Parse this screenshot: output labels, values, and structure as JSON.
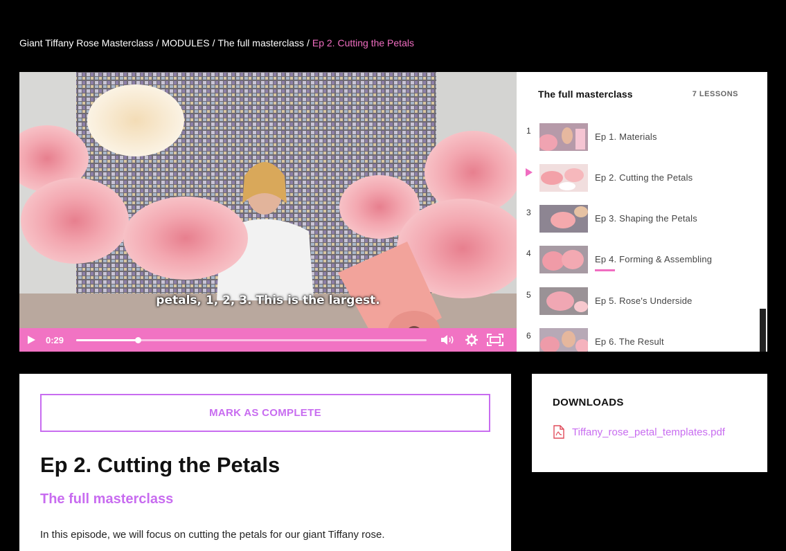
{
  "breadcrumb": {
    "course": "Giant Tiffany Rose Masterclass",
    "section": "MODULES",
    "module": "The full masterclass",
    "current": "Ep 2. Cutting the Petals",
    "separator": "/"
  },
  "video": {
    "caption": "petals, 1, 2, 3. This is the largest.",
    "time": "0:29",
    "progress": 0.175,
    "controls": [
      "play-icon",
      "volume-icon",
      "settings-icon",
      "fullscreen-icon"
    ]
  },
  "lessons": {
    "title": "The full masterclass",
    "count": "7 LESSONS",
    "items": [
      {
        "num": "1",
        "label": "Ep 1. Materials"
      },
      {
        "num": "",
        "label": "Ep 2. Cutting the Petals",
        "playing": true
      },
      {
        "num": "3",
        "label": "Ep 3. Shaping the Petals"
      },
      {
        "num": "4",
        "label": "Ep 4. Forming & Assembling",
        "in_progress": true
      },
      {
        "num": "5",
        "label": "Ep 5. Rose's Underside"
      },
      {
        "num": "6",
        "label": "Ep 6. The Result"
      }
    ]
  },
  "main": {
    "complete_label": "MARK AS COMPLETE",
    "title": "Ep 2. Cutting the Petals",
    "module": "The full masterclass",
    "description": "In this episode, we will focus on cutting the petals for our giant Tiffany rose."
  },
  "downloads": {
    "title": "DOWNLOADS",
    "file": "Tiffany_rose_petal_templates.pdf",
    "icon": "pdf-file-icon"
  },
  "colors": {
    "accent_pink": "#f06dc1",
    "accent_purple": "#c86cf0",
    "control_bar": "#f173c3"
  }
}
